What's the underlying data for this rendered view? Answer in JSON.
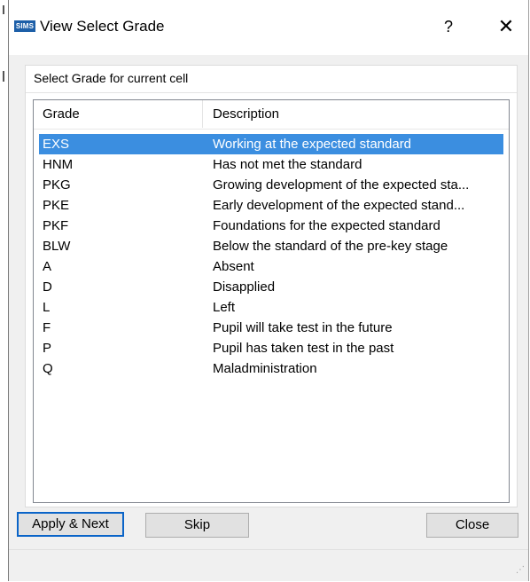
{
  "window": {
    "app_icon_text": "SIMS",
    "title": "View Select Grade",
    "help_glyph": "?",
    "close_glyph": "✕"
  },
  "group": {
    "caption": "Select Grade for current cell"
  },
  "list": {
    "columns": {
      "grade": "Grade",
      "description": "Description"
    },
    "selected_index": 0,
    "rows": [
      {
        "grade": "EXS",
        "description": "Working at the expected standard"
      },
      {
        "grade": "HNM",
        "description": "Has not met the standard"
      },
      {
        "grade": "PKG",
        "description": "Growing development of the expected sta..."
      },
      {
        "grade": "PKE",
        "description": "Early development of the expected stand..."
      },
      {
        "grade": "PKF",
        "description": "Foundations for the expected standard"
      },
      {
        "grade": "BLW",
        "description": "Below the standard of the pre-key stage"
      },
      {
        "grade": "A",
        "description": "Absent"
      },
      {
        "grade": "D",
        "description": "Disapplied"
      },
      {
        "grade": "L",
        "description": "Left"
      },
      {
        "grade": "F",
        "description": "Pupil will take test in the future"
      },
      {
        "grade": "P",
        "description": "Pupil has taken test in the past"
      },
      {
        "grade": "Q",
        "description": "Maladministration"
      }
    ]
  },
  "buttons": {
    "apply_next": "Apply & Next",
    "skip": "Skip",
    "close": "Close"
  },
  "colors": {
    "selection": "#3b8ee0",
    "app_icon": "#1d5fa8",
    "dialog_bg": "#f0f0f0"
  }
}
